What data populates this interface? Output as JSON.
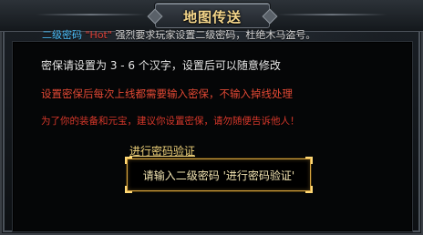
{
  "window": {
    "title": "地图传送"
  },
  "notice": {
    "part1": "二级密码",
    "part2": "\"Hot\"",
    "part3": "强烈要求玩家设置二级密码，杜绝木马盗号。"
  },
  "panel": {
    "line1": "密保请设置为 3 - 6 个汉字，设置后可以随意修改",
    "line2": "设置密保后每次上线都需要输入密保，不输入掉线处理",
    "line3": "为了你的装备和元宝，建议你设置密保，请勿随便告诉他人！",
    "verify_link": "进行密码验证",
    "verify_prompt": "请输入二级密码 '进行密码验证'"
  },
  "colors": {
    "title": "#f3d58a",
    "notice_blue": "#4fc3ff",
    "notice_red": "#e0433a",
    "warning_red": "#e34a36",
    "link_gold": "#f0d27a",
    "box_border": "#d9a640"
  }
}
